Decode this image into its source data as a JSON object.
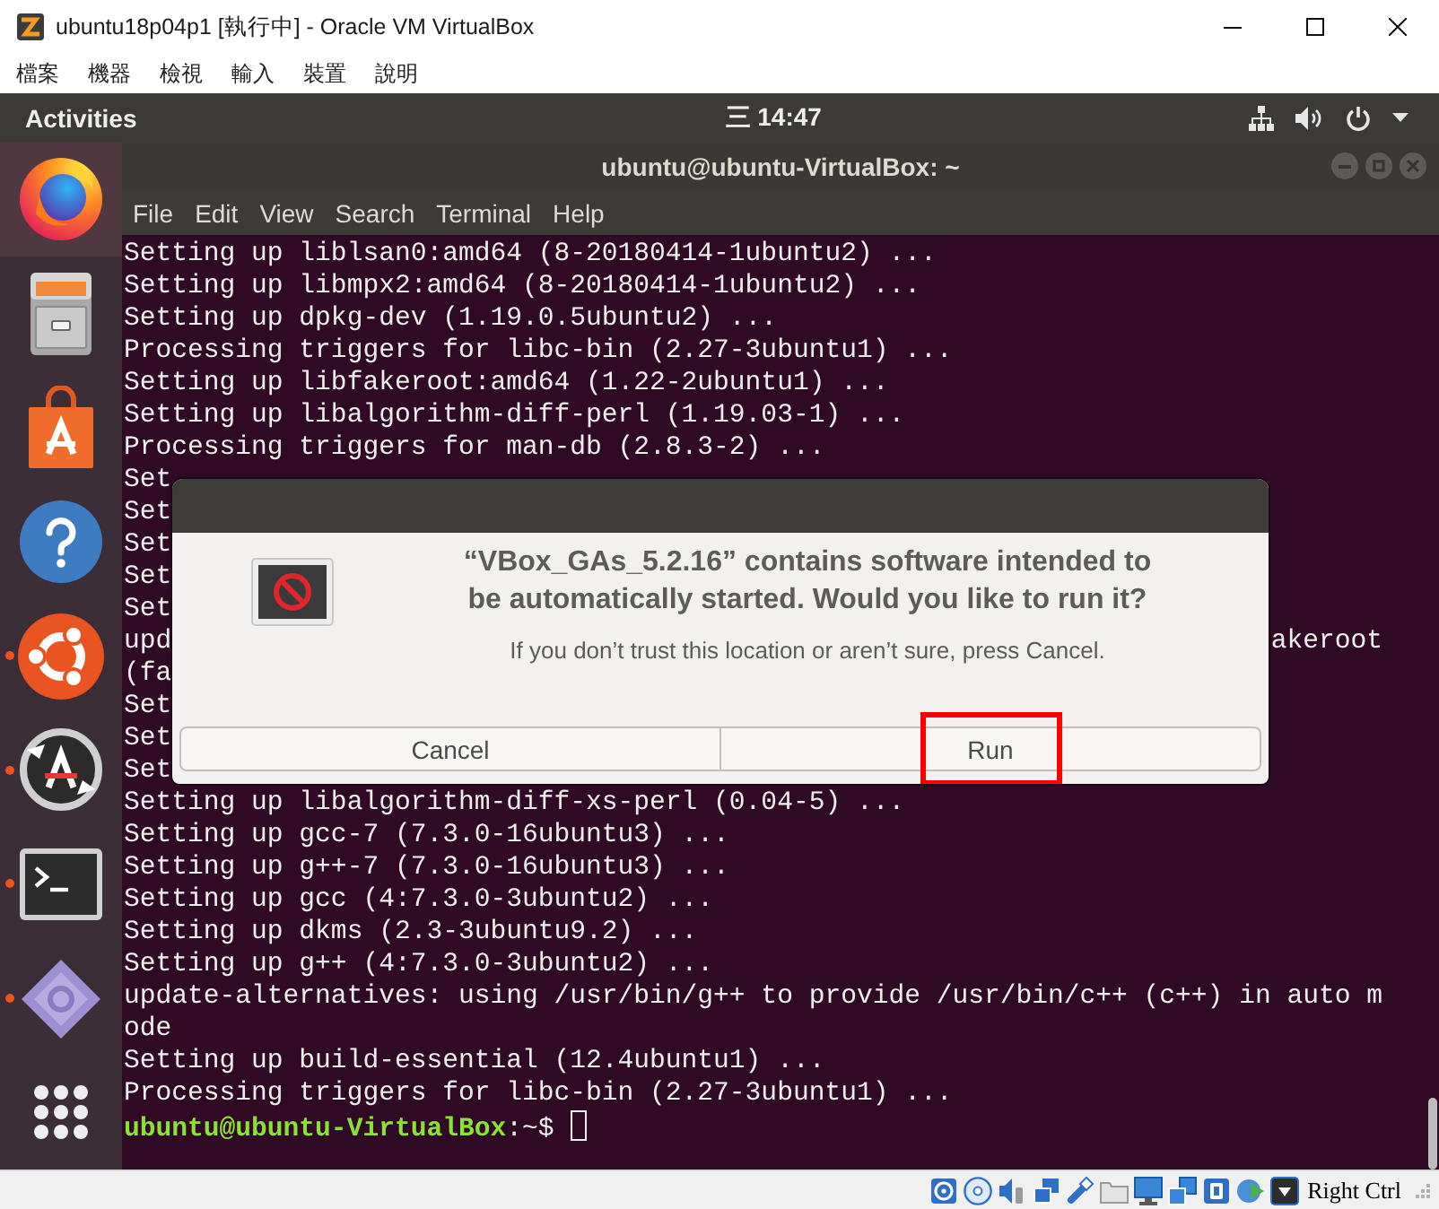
{
  "window": {
    "title": "ubuntu18p04p1 [執行中] - Oracle VM VirtualBox"
  },
  "menu": [
    "檔案",
    "機器",
    "檢視",
    "輸入",
    "裝置",
    "說明"
  ],
  "top_bar": {
    "activities": "Activities",
    "clock": "三 14:47"
  },
  "dock": [
    {
      "kind": "browser",
      "selected": true,
      "running": false
    },
    {
      "kind": "files",
      "selected": false,
      "running": false
    },
    {
      "kind": "software",
      "selected": false,
      "running": false
    },
    {
      "kind": "help",
      "selected": false,
      "running": false
    },
    {
      "kind": "ubuntu",
      "selected": false,
      "running": true
    },
    {
      "kind": "updater",
      "selected": false,
      "running": true
    },
    {
      "kind": "terminal",
      "selected": false,
      "running": true
    },
    {
      "kind": "executable",
      "selected": false,
      "running": true
    },
    {
      "kind": "apps",
      "selected": false,
      "running": false
    }
  ],
  "terminal": {
    "title": "ubuntu@ubuntu-VirtualBox: ~",
    "menu": [
      "File",
      "Edit",
      "View",
      "Search",
      "Terminal",
      "Help"
    ],
    "lines": [
      {
        "kind": "text",
        "text": "Setting up liblsan0:amd64 (8-20180414-1ubuntu2) ..."
      },
      {
        "kind": "text",
        "text": "Setting up libmpx2:amd64 (8-20180414-1ubuntu2) ..."
      },
      {
        "kind": "text",
        "text": "Setting up dpkg-dev (1.19.0.5ubuntu2) ..."
      },
      {
        "kind": "text",
        "text": "Processing triggers for libc-bin (2.27-3ubuntu1) ..."
      },
      {
        "kind": "text",
        "text": "Setting up libfakeroot:amd64 (1.22-2ubuntu1) ..."
      },
      {
        "kind": "text",
        "text": "Setting up libalgorithm-diff-perl (1.19.03-1) ..."
      },
      {
        "kind": "text",
        "text": "Processing triggers for man-db (2.8.3-2) ..."
      },
      {
        "kind": "clipped",
        "left": "Set"
      },
      {
        "kind": "clipped",
        "left": "Set"
      },
      {
        "kind": "clipped",
        "left": "Set"
      },
      {
        "kind": "clipped",
        "left": "Set"
      },
      {
        "kind": "clipped",
        "left": "Set"
      },
      {
        "kind": "clipped",
        "left": "upd",
        "right": "akeroot"
      },
      {
        "kind": "clipped",
        "left": "(fa"
      },
      {
        "kind": "clipped",
        "left": "Set"
      },
      {
        "kind": "clipped",
        "left": "Set"
      },
      {
        "kind": "clipped",
        "left": "Set"
      },
      {
        "kind": "text",
        "text": "Setting up libalgorithm-diff-xs-perl (0.04-5) ..."
      },
      {
        "kind": "text",
        "text": "Setting up gcc-7 (7.3.0-16ubuntu3) ..."
      },
      {
        "kind": "text",
        "text": "Setting up g++-7 (7.3.0-16ubuntu3) ..."
      },
      {
        "kind": "text",
        "text": "Setting up gcc (4:7.3.0-3ubuntu2) ..."
      },
      {
        "kind": "text",
        "text": "Setting up dkms (2.3-3ubuntu9.2) ..."
      },
      {
        "kind": "text",
        "text": "Setting up g++ (4:7.3.0-3ubuntu2) ..."
      },
      {
        "kind": "text",
        "text": "update-alternatives: using /usr/bin/g++ to provide /usr/bin/c++ (c++) in auto m"
      },
      {
        "kind": "text",
        "text": "ode"
      },
      {
        "kind": "text",
        "text": "Setting up build-essential (12.4ubuntu1) ..."
      },
      {
        "kind": "text",
        "text": "Processing triggers for libc-bin (2.27-3ubuntu1) ..."
      },
      {
        "kind": "prompt",
        "user_host": "ubuntu@ubuntu-VirtualBox",
        "path": ":~$"
      }
    ]
  },
  "dialog": {
    "title_lines": [
      "“VBox_GAs_5.2.16” contains software intended to",
      "be automatically started. Would you like to run it?"
    ],
    "message": "If you don’t trust this location or aren’t sure, press Cancel.",
    "buttons": [
      {
        "label": "Cancel",
        "highlighted": false
      },
      {
        "label": "Run",
        "highlighted": true
      }
    ]
  },
  "status_bar": {
    "host_key": "Right Ctrl"
  }
}
